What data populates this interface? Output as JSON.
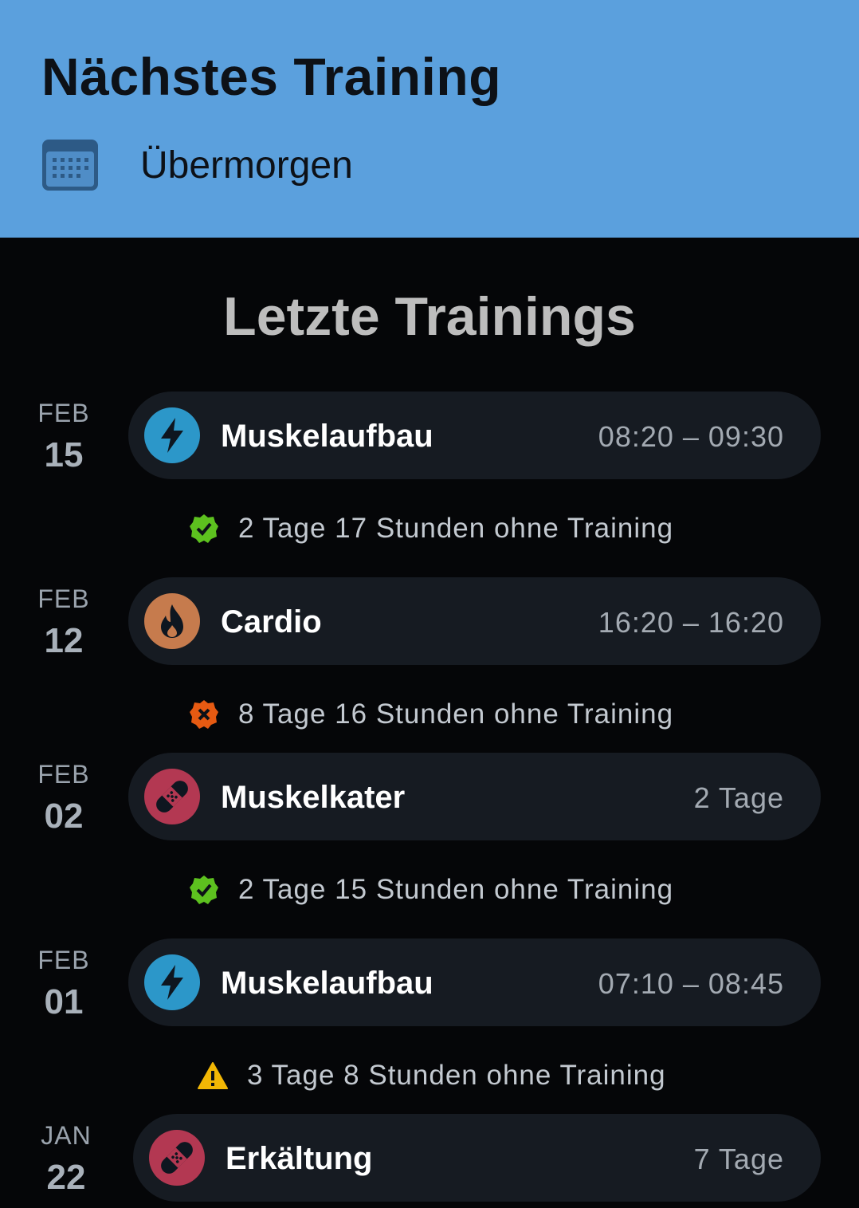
{
  "header": {
    "title": "Nächstes Training",
    "subtitle": "Übermorgen",
    "calendar_icon": "calendar-icon"
  },
  "section_title": "Letzte Trainings",
  "colors": {
    "header_bg": "#5ba0dd",
    "strength": "#2c97c9",
    "cardio": "#c67b4d",
    "injury": "#b33852",
    "ok": "#5dc11f",
    "bad": "#e65a12",
    "warn": "#f2b705"
  },
  "entries": [
    {
      "month": "FEB",
      "day": "15",
      "name": "Muskelaufbau",
      "right": "08:20 – 09:30",
      "icon": "lightning-icon"
    },
    {
      "month": "FEB",
      "day": "12",
      "name": "Cardio",
      "right": "16:20 – 16:20",
      "icon": "flame-icon"
    },
    {
      "month": "FEB",
      "day": "02",
      "name": "Muskelkater",
      "right": "2 Tage",
      "icon": "bandage-icon"
    },
    {
      "month": "FEB",
      "day": "01",
      "name": "Muskelaufbau",
      "right": "07:10 – 08:45",
      "icon": "lightning-icon"
    },
    {
      "month": "JAN",
      "day": "22",
      "name": "Erkältung",
      "right": "7 Tage",
      "icon": "bandage-icon"
    }
  ],
  "gaps": [
    {
      "text": "2 Tage 17 Stunden ohne Training",
      "status": "ok",
      "icon": "check-badge-icon"
    },
    {
      "text": "8 Tage 16 Stunden ohne Training",
      "status": "bad",
      "icon": "cross-badge-icon"
    },
    {
      "text": "2 Tage 15 Stunden ohne Training",
      "status": "ok",
      "icon": "check-badge-icon"
    },
    {
      "text": "3 Tage 8 Stunden ohne Training",
      "status": "warn",
      "icon": "warning-icon"
    }
  ]
}
